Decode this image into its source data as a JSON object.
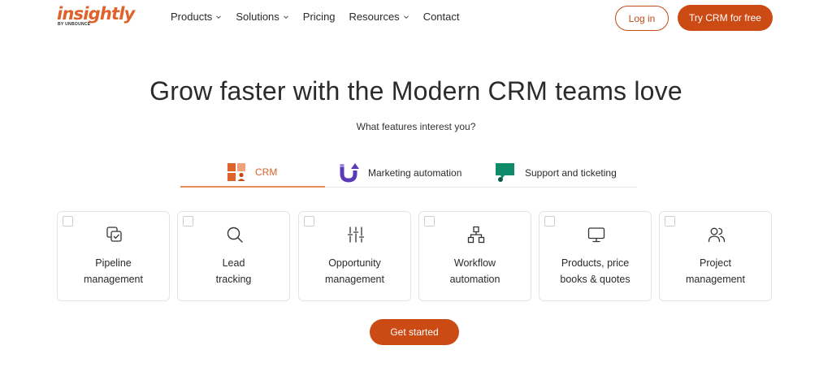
{
  "header": {
    "logo_text": "insightly",
    "logo_subtext": "BY UNBOUNCE",
    "nav": [
      {
        "label": "Products",
        "has_dropdown": true
      },
      {
        "label": "Solutions",
        "has_dropdown": true
      },
      {
        "label": "Pricing",
        "has_dropdown": false
      },
      {
        "label": "Resources",
        "has_dropdown": true
      },
      {
        "label": "Contact",
        "has_dropdown": false
      }
    ],
    "login_label": "Log in",
    "try_label": "Try CRM for free"
  },
  "hero": {
    "title": "Grow faster with the Modern CRM teams love",
    "subtitle": "What features interest you?"
  },
  "tabs": [
    {
      "label": "CRM",
      "icon": "crm-blocks-icon",
      "active": true
    },
    {
      "label": "Marketing automation",
      "icon": "magnet-icon",
      "active": false
    },
    {
      "label": "Support and ticketing",
      "icon": "support-chat-icon",
      "active": false
    }
  ],
  "cards": [
    {
      "line1": "Pipeline",
      "line2": "management",
      "icon": "pipeline-icon"
    },
    {
      "line1": "Lead",
      "line2": "tracking",
      "icon": "search-icon"
    },
    {
      "line1": "Opportunity",
      "line2": "management",
      "icon": "sliders-icon"
    },
    {
      "line1": "Workflow",
      "line2": "automation",
      "icon": "workflow-icon"
    },
    {
      "line1": "Products, price",
      "line2": "books & quotes",
      "icon": "monitor-icon"
    },
    {
      "line1": "Project",
      "line2": "management",
      "icon": "users-icon"
    }
  ],
  "cta": {
    "label": "Get started"
  },
  "colors": {
    "brand_orange": "#e0622b",
    "button_orange": "#cc4a14",
    "tab_active_underline": "#e88b5a",
    "marketing_purple": "#5b3ab8",
    "support_green": "#0f8a6a"
  }
}
